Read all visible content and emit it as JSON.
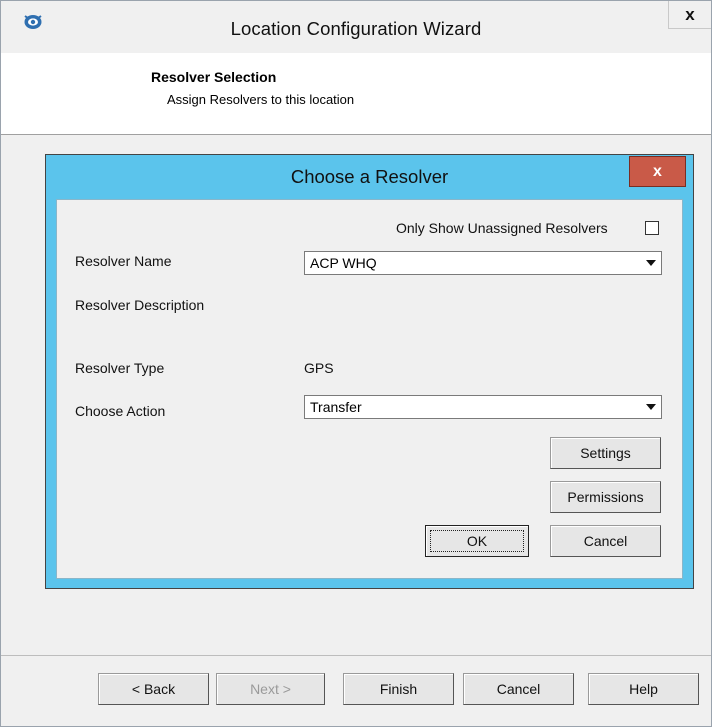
{
  "window": {
    "title": "Location Configuration Wizard",
    "close_label": "x",
    "icon": "app-icon"
  },
  "header": {
    "title": "Resolver Selection",
    "subtitle": "Assign Resolvers to this location"
  },
  "dialog": {
    "title": "Choose a Resolver",
    "close_label": "x",
    "unassigned_label": "Only Show Unassigned Resolvers",
    "unassigned_checked": false,
    "resolver_name_label": "Resolver Name",
    "resolver_name_value": "ACP WHQ",
    "resolver_description_label": "Resolver Description",
    "resolver_type_label": "Resolver Type",
    "resolver_type_value": "GPS",
    "choose_action_label": "Choose Action",
    "choose_action_value": "Transfer",
    "settings_label": "Settings",
    "permissions_label": "Permissions",
    "ok_label": "OK",
    "cancel_label": "Cancel"
  },
  "footer": {
    "back_label": "< Back",
    "next_label": "Next >",
    "finish_label": "Finish",
    "cancel_label": "Cancel",
    "help_label": "Help"
  },
  "colors": {
    "dialog_frame": "#5bc4ec",
    "close_button": "#c95a48",
    "window_bg": "#f0f0f0"
  }
}
